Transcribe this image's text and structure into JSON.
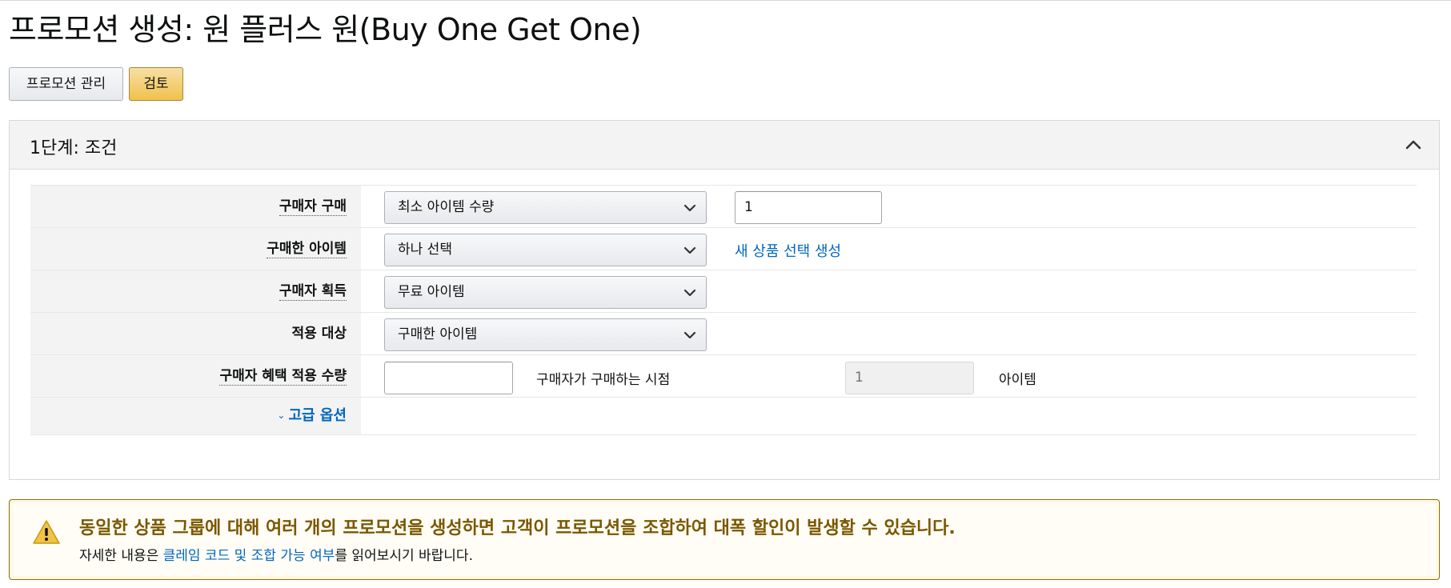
{
  "page": {
    "title": "프로모션 생성: 원 플러스 원(Buy One Get One)"
  },
  "actions": {
    "manage_label": "프로모션 관리",
    "review_label": "검토"
  },
  "step": {
    "title": "1단계: 조건",
    "rows": {
      "buyer_purchase": {
        "label": "구매자 구매",
        "select_value": "최소 아이템 수량",
        "input_value": "1"
      },
      "purchased_items": {
        "label": "구매한 아이템",
        "select_value": "하나 선택",
        "link": "새 상품 선택 생성"
      },
      "buyer_gets": {
        "label": "구매자 획득",
        "select_value": "무료 아이템"
      },
      "applies_to": {
        "label": "적용 대상",
        "select_value": "구매한 아이템"
      },
      "benefit_qty": {
        "label": "구매자 혜택 적용 수량",
        "input_value": "",
        "middle_text": "구매자가 구매하는 시점",
        "disabled_value": "1",
        "unit_text": "아이템"
      },
      "advanced": {
        "caret": "⌄",
        "label": "고급 옵션"
      }
    }
  },
  "alert": {
    "heading": "동일한 상품 그룹에 대해 여러 개의 프로모션을 생성하면 고객이 프로모션을 조합하여 대폭 할인이 발생할 수 있습니다.",
    "detail_prefix": "자세한 내용은 ",
    "detail_link": "클레임 코드 및 조합 가능 여부",
    "detail_suffix": "를 읽어보시기 바랍니다."
  },
  "colors": {
    "link": "#0066c0",
    "primary_button": "#f0c14b",
    "alert_heading": "#7a5700",
    "alert_border": "#8c6e00"
  }
}
